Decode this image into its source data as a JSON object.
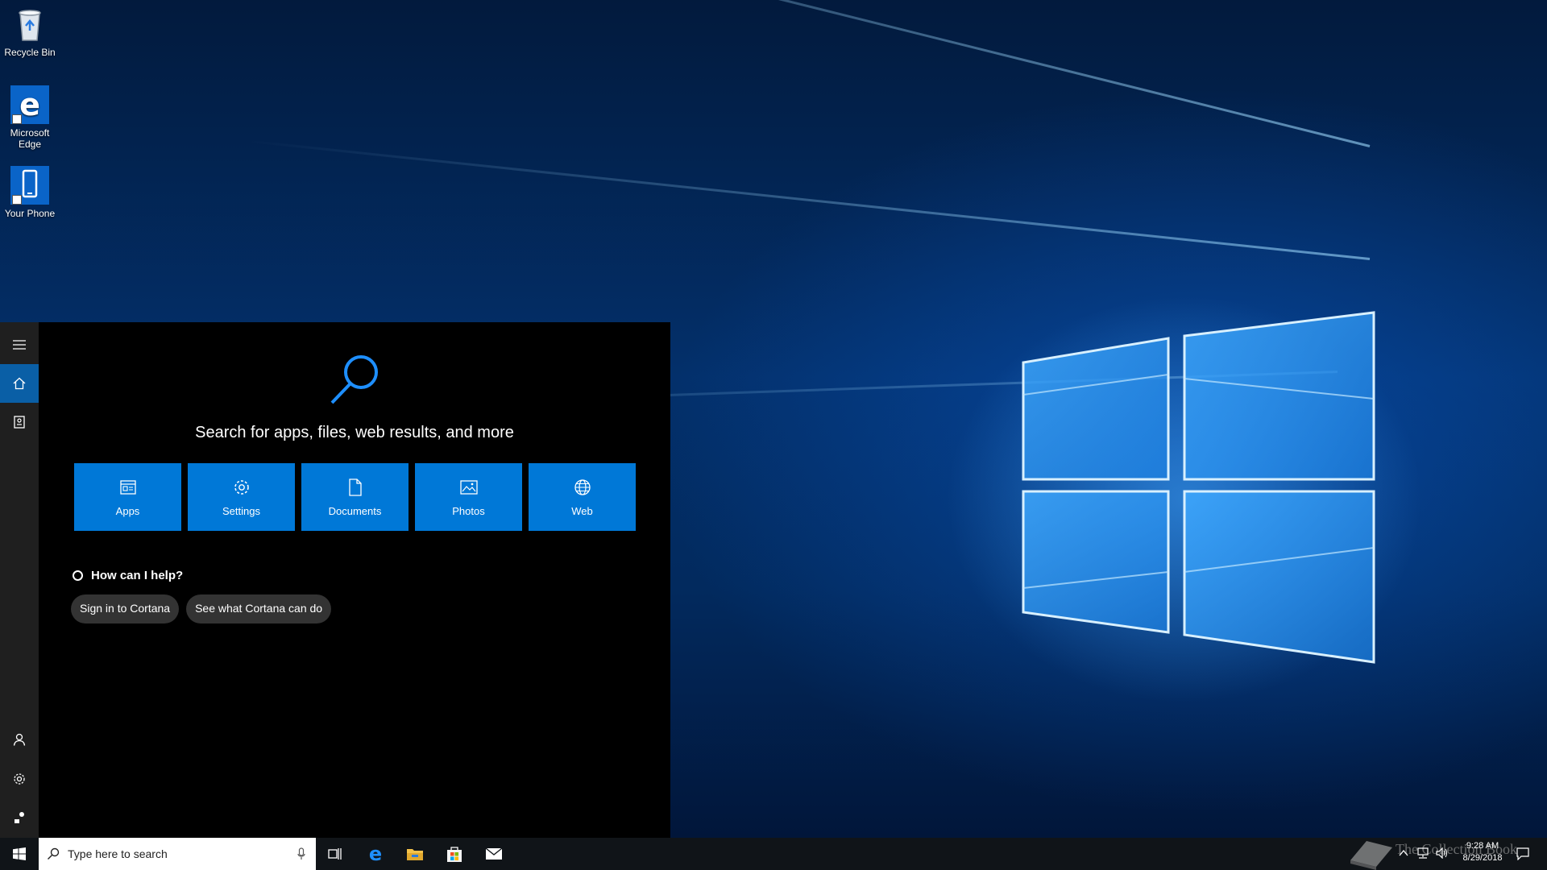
{
  "desktop": {
    "icons": [
      {
        "label": "Recycle Bin",
        "icon": "recycle-bin-icon"
      },
      {
        "label": "Microsoft Edge",
        "icon": "edge-icon"
      },
      {
        "label": "Your Phone",
        "icon": "phone-icon"
      }
    ]
  },
  "search_panel": {
    "rail": [
      {
        "icon": "hamburger-menu-icon"
      },
      {
        "icon": "home-icon"
      },
      {
        "icon": "notebook-icon"
      },
      {
        "icon": "person-icon"
      },
      {
        "icon": "gear-icon"
      },
      {
        "icon": "feedback-icon"
      }
    ],
    "headline": "Search for apps, files, web results, and more",
    "tiles": [
      {
        "label": "Apps",
        "icon": "apps-icon"
      },
      {
        "label": "Settings",
        "icon": "gear-icon"
      },
      {
        "label": "Documents",
        "icon": "document-icon"
      },
      {
        "label": "Photos",
        "icon": "photo-icon"
      },
      {
        "label": "Web",
        "icon": "globe-icon"
      }
    ],
    "help_prompt": "How can I help?",
    "help_buttons": [
      "Sign in to Cortana",
      "See what Cortana can do"
    ]
  },
  "taskbar": {
    "search_placeholder": "Type here to search",
    "apps": [
      "task-view-icon",
      "edge-icon",
      "file-explorer-icon",
      "store-icon",
      "mail-icon"
    ],
    "watermark": "The Collection Book",
    "time": "9:28 AM",
    "date": "8/29/2018"
  },
  "colors": {
    "accent": "#0078d7",
    "panel_bg": "#000000",
    "rail_bg": "#1f1f1f",
    "taskbar_bg": "#101418",
    "pill_bg": "#333333"
  }
}
